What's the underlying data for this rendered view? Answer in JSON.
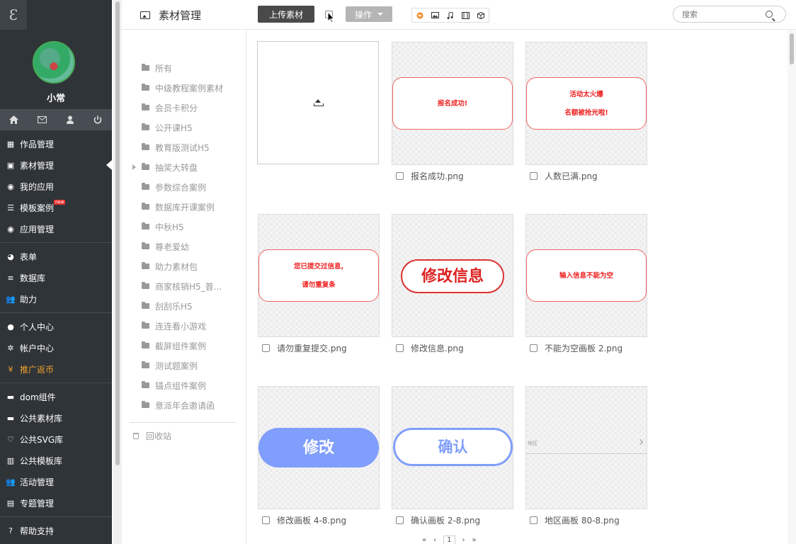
{
  "sidebar": {
    "logo": "Ɛ",
    "user_name": "小常",
    "quick_icons": [
      "home-icon",
      "mail-icon",
      "user-icon",
      "power-icon"
    ],
    "groups": [
      [
        {
          "label": "作品管理",
          "icon": "grid-icon"
        },
        {
          "label": "素材管理",
          "icon": "image-icon",
          "active": true
        },
        {
          "label": "我的应用",
          "icon": "app-icon"
        },
        {
          "label": "模板案例",
          "icon": "list-icon",
          "badge": "new"
        },
        {
          "label": "应用管理",
          "icon": "app-manage-icon"
        }
      ],
      [
        {
          "label": "表单",
          "icon": "pie-icon"
        },
        {
          "label": "数据库",
          "icon": "database-icon"
        },
        {
          "label": "助力",
          "icon": "users-icon"
        }
      ],
      [
        {
          "label": "个人中心",
          "icon": "person-icon"
        },
        {
          "label": "帐户中心",
          "icon": "gear-icon"
        },
        {
          "label": "推广返币",
          "icon": "yen-icon",
          "highlight": "#f0a030"
        }
      ],
      [
        {
          "label": "dom组件",
          "icon": "briefcase-icon"
        },
        {
          "label": "公共素材库",
          "icon": "briefcase-icon"
        },
        {
          "label": "公共SVG库",
          "icon": "heart-icon"
        },
        {
          "label": "公共模板库",
          "icon": "building-icon"
        },
        {
          "label": "活动管理",
          "icon": "users-icon"
        },
        {
          "label": "专题管理",
          "icon": "book-icon"
        }
      ],
      [
        {
          "label": "帮助支持",
          "icon": "help-icon"
        }
      ]
    ]
  },
  "header": {
    "title": "素材管理",
    "upload_label": "上传素材",
    "ops_label": "操作",
    "type_filters": [
      "all-types-icon",
      "image-type-icon",
      "music-type-icon",
      "video-type-icon",
      "3d-type-icon"
    ],
    "search_placeholder": "搜索"
  },
  "folders": {
    "items": [
      "所有",
      "中级教程案例素材",
      "会员卡积分",
      "公开课H5",
      "教育版测试H5",
      "抽奖大转盘",
      "参数综合案例",
      "数据库开课案例",
      "中秋H5",
      "尊老爱幼",
      "助力素材包",
      "商家核销H5_普...",
      "刮刮乐H5",
      "连连看小游戏",
      "截屏组件案例",
      "测试题案例",
      "锚点组件案例",
      "意派年会邀请函"
    ],
    "expandable_index": 5,
    "recycle_label": "回收站"
  },
  "assets": [
    {
      "name": "报名成功.png",
      "preview": "报名成功!",
      "style": "pill"
    },
    {
      "name": "人数已满.png",
      "preview_lines": [
        "活动太火爆",
        "名额被抢光啦!"
      ],
      "style": "pill2"
    },
    {
      "name": "请勿重复提交.png",
      "preview_lines": [
        "您已提交过信息,",
        "请勿重复条"
      ],
      "style": "pill2"
    },
    {
      "name": "修改信息.png",
      "preview": "修改信息",
      "style": "big"
    },
    {
      "name": "不能为空画板 2.png",
      "preview": "输入信息不能为空",
      "style": "pill"
    },
    {
      "name": "修改画板 4-8.png",
      "preview": "修改",
      "style": "blue"
    },
    {
      "name": "确认画板 2-8.png",
      "preview": "确认",
      "style": "blue-out"
    },
    {
      "name": "地区画板 80-8.png",
      "preview": "地区",
      "style": "region"
    }
  ],
  "pager": {
    "first": "«",
    "prev": "‹",
    "current": "1",
    "next": "›",
    "last": "»"
  },
  "colors": {
    "sidebar_bg": "#2f3438",
    "accent_blue": "#809efb",
    "accent_red": "#e22",
    "promo_orange": "#f0a030"
  }
}
